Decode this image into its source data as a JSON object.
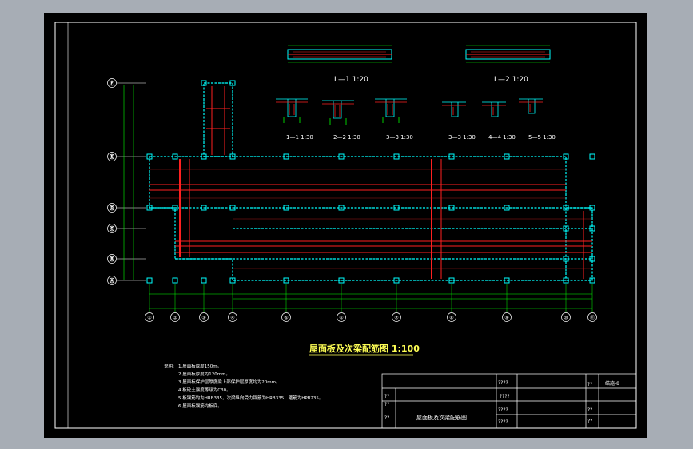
{
  "colors": {
    "app_background": "#a7adb5",
    "canvas_background": "#000000",
    "frame": "#ffffff",
    "slab_outline": "#00ffff",
    "rebar": "#ff2020",
    "dimension": "#00ff00",
    "text": "#ffff55"
  },
  "drawing": {
    "title": "屋面板及次梁配筋图 1:100",
    "top_sections": {
      "left_label": "L—1 1:20",
      "right_label": "L—2 1:20"
    },
    "section_labels": [
      "1—1 1:30",
      "2—2 1:30",
      "3—3 1:30",
      "3—3 1:30",
      "4—4 1:30",
      "5—5 1:30"
    ],
    "grid_columns": [
      "①",
      "②",
      "③",
      "④",
      "⑤",
      "⑥",
      "⑦",
      "⑧",
      "⑨",
      "⑩",
      "⑪"
    ],
    "grid_rows": [
      "Ⓕ",
      "Ⓔ",
      "Ⓓ",
      "Ⓒ",
      "Ⓑ",
      "Ⓐ"
    ],
    "notes": {
      "heading": "说明:",
      "items": [
        "1.屋面板厚度150m。",
        "2.屋面板厚度为120mm。",
        "3.屋面板保护层厚度梁上部保护层厚度均为20mm。",
        "4.板砼土强度等级为C30。",
        "5.板钢筋均为HRB335，次梁纵向受力钢筋为HRB335，箍筋为HPB235。",
        "6.屋面板钢筋均板底。"
      ]
    }
  },
  "title_block": {
    "drawing_name": "屋面板及次梁配筋图",
    "sheet_no": "结施-8",
    "cells": [
      "????",
      "??",
      "????",
      "??",
      "??",
      "????",
      "??",
      "??",
      "??",
      "????"
    ]
  }
}
